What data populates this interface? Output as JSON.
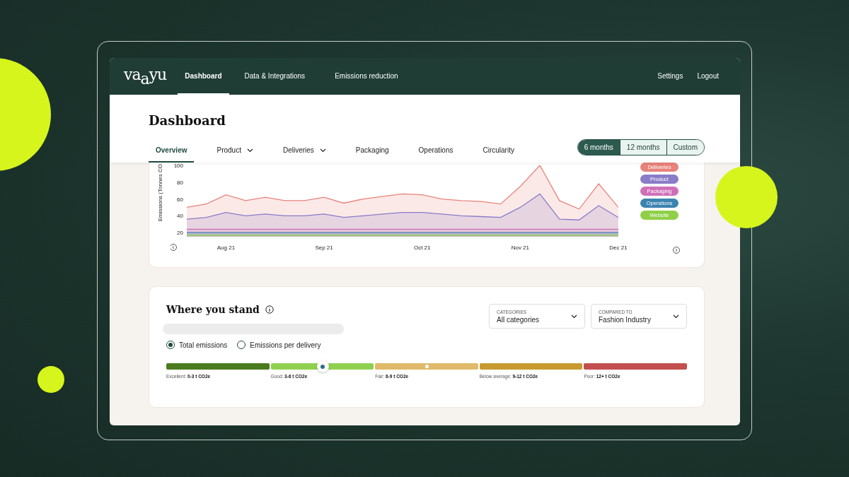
{
  "nav": {
    "logo": "va$_{a}$yu",
    "items": [
      {
        "label": "Dashboard",
        "selected": true
      },
      {
        "label": "Data & Integrations",
        "selected": false
      },
      {
        "label": "Emissions reduction",
        "selected": false
      }
    ],
    "right_items": [
      "Settings",
      "Logout"
    ]
  },
  "page": {
    "title": "Dashboard",
    "tabs": [
      {
        "label": "Overview",
        "selected": true,
        "dropdown": false
      },
      {
        "label": "Product",
        "selected": false,
        "dropdown": true
      },
      {
        "label": "Deliveries",
        "selected": false,
        "dropdown": true
      },
      {
        "label": "Packaging",
        "selected": false,
        "dropdown": false
      },
      {
        "label": "Operations",
        "selected": false,
        "dropdown": false
      },
      {
        "label": "Circularity",
        "selected": false,
        "dropdown": false
      }
    ],
    "ranges": [
      {
        "label": "6 months",
        "selected": true
      },
      {
        "label": "12 months",
        "selected": false
      },
      {
        "label": "Custom",
        "selected": false
      }
    ]
  },
  "emissions_chart": {
    "chart_data": {
      "type": "area",
      "ylabel": "Emissions (Tonnes CO",
      "ylim": [
        15,
        100
      ],
      "yticks": [
        20,
        40,
        60,
        80,
        100
      ],
      "categories": [
        null,
        null,
        "Aug 21",
        null,
        null,
        null,
        null,
        "Sep 21",
        null,
        null,
        null,
        null,
        "Oct 21",
        null,
        null,
        null,
        null,
        "Nov 21",
        null,
        null,
        null,
        null,
        "Dec 21"
      ],
      "stacked": false,
      "series": [
        {
          "name": "Deliveries",
          "color": "#e8837b",
          "values": [
            50,
            54,
            65,
            58,
            62,
            58,
            58,
            62,
            55,
            60,
            63,
            66,
            65,
            60,
            58,
            57,
            54,
            75,
            100,
            58,
            48,
            78,
            50
          ]
        },
        {
          "name": "Product",
          "color": "#8a7cc8",
          "values": [
            36,
            38,
            44,
            40,
            42,
            40,
            40,
            42,
            38,
            40,
            42,
            44,
            44,
            42,
            40,
            39,
            38,
            50,
            66,
            36,
            35,
            52,
            38
          ]
        },
        {
          "name": "Packaging",
          "color": "#d070b8",
          "values": [
            24,
            24,
            24,
            24,
            24,
            24,
            24,
            24,
            24,
            24,
            24,
            24,
            24,
            24,
            24,
            24,
            24,
            24,
            24,
            24,
            24,
            24,
            24
          ]
        },
        {
          "name": "Operations",
          "color": "#3b83b0",
          "values": [
            20,
            20,
            20,
            20,
            20,
            20,
            20,
            20,
            20,
            20,
            20,
            20,
            20,
            20,
            20,
            20,
            20,
            20,
            20,
            20,
            20,
            20,
            20
          ]
        },
        {
          "name": "Website",
          "color": "#8fd048",
          "values": [
            17,
            17,
            17,
            17,
            17,
            17,
            17,
            17,
            17,
            17,
            17,
            17,
            17,
            17,
            17,
            17,
            17,
            17,
            17,
            17,
            17,
            17,
            17
          ]
        }
      ]
    }
  },
  "where_you_stand": {
    "title": "Where you stand",
    "dropdowns": [
      {
        "label": "CATEGORIES",
        "value": "All categories"
      },
      {
        "label": "COMPARED TO",
        "value": "Fashion Industry"
      }
    ],
    "options": [
      {
        "label": "Total emissions",
        "selected": true
      },
      {
        "label": "Emissions per delivery",
        "selected": false
      }
    ],
    "marker": {
      "level": 0.3
    },
    "benchmark": {
      "level": 0.5
    },
    "bands": [
      {
        "label": "Excellent: **0-3 t CO2e**",
        "color": "#4a7c1e"
      },
      {
        "label": "Good: **3-6 t CO2e**",
        "color": "#8fd14f"
      },
      {
        "label": "Fair: **6-9 t CO2e**",
        "color": "#e0b96a"
      },
      {
        "label": "Below average: **9-12 t CO2e**",
        "color": "#c69a2e"
      },
      {
        "label": "Poor: **12+ t CO2e**",
        "color": "#c44e4e"
      }
    ]
  }
}
